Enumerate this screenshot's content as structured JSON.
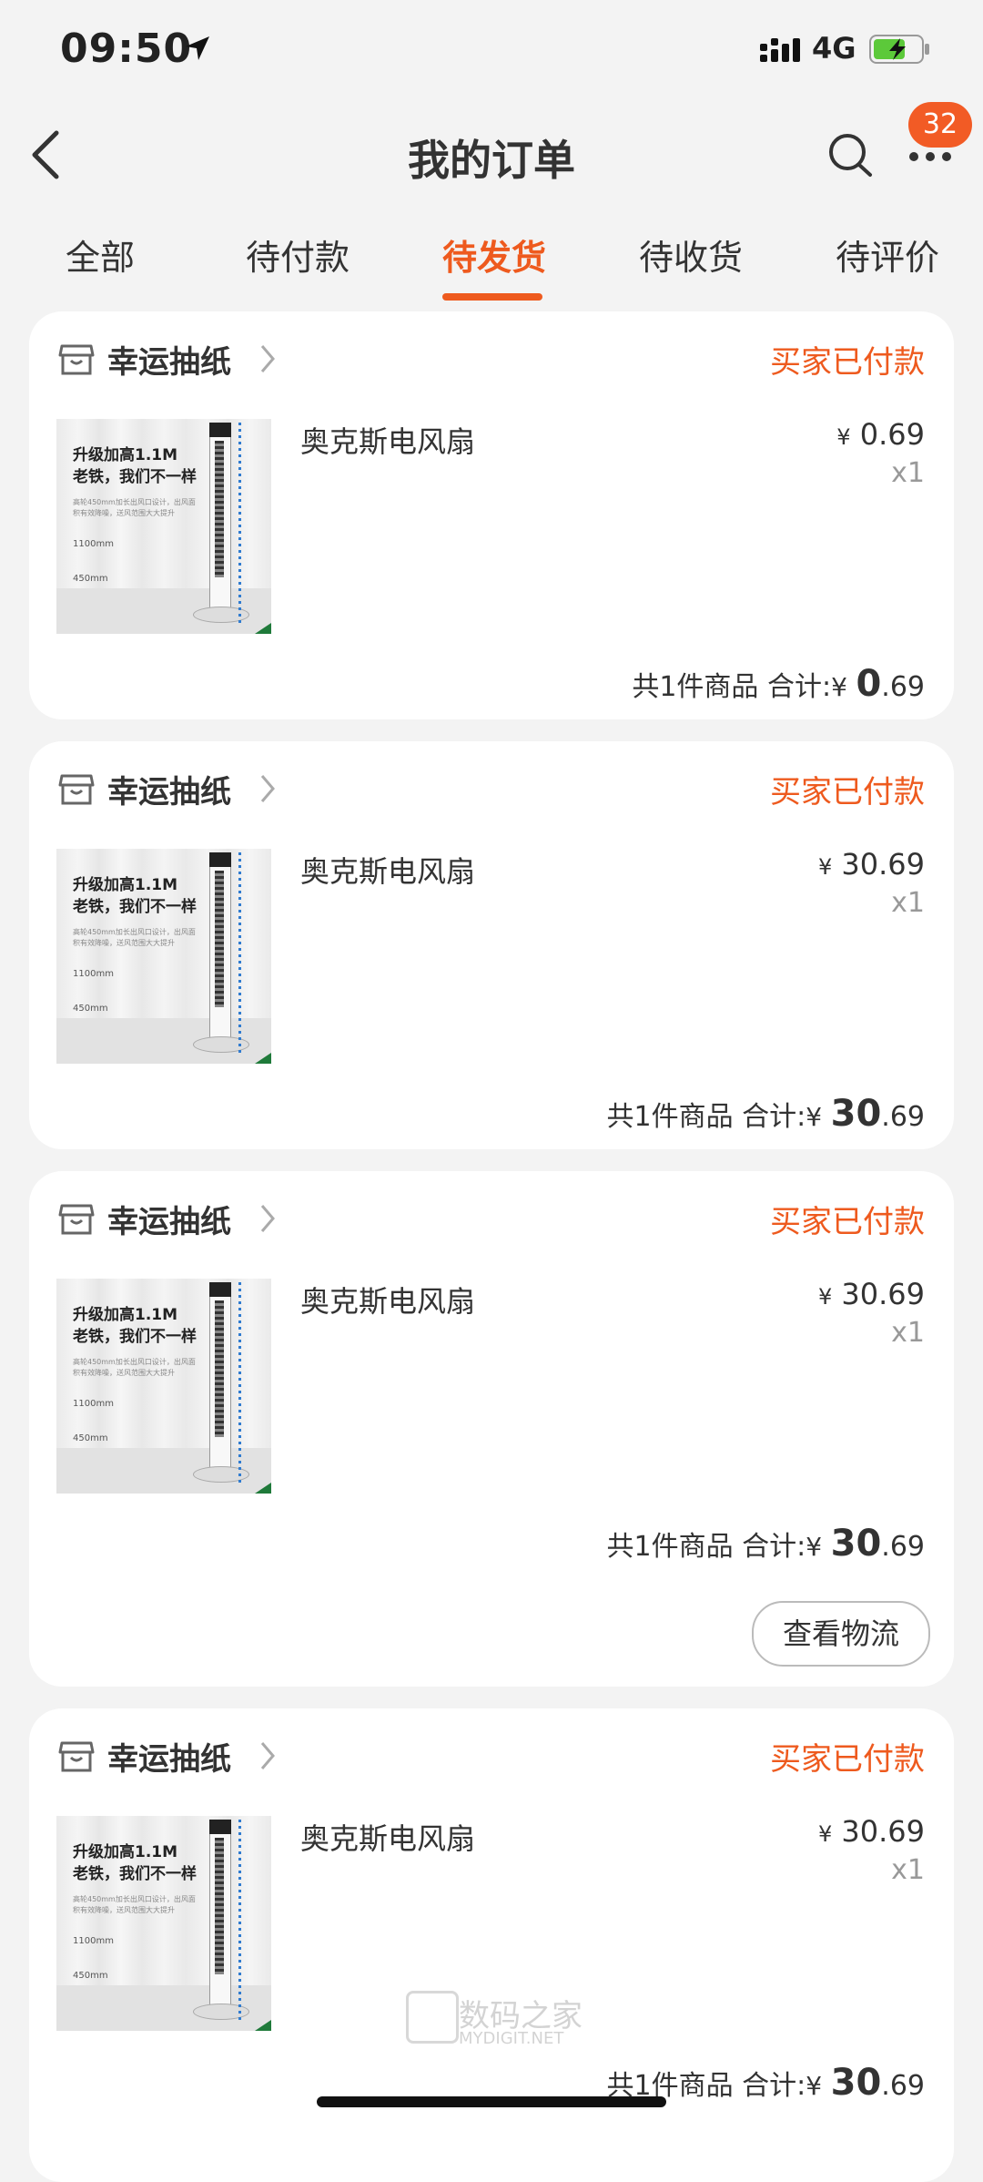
{
  "status_bar": {
    "time": "09:50",
    "network": "4G"
  },
  "header": {
    "title": "我的订单",
    "badge_count": "32"
  },
  "tabs": [
    {
      "label": "全部",
      "active": false
    },
    {
      "label": "待付款",
      "active": false
    },
    {
      "label": "待发货",
      "active": true
    },
    {
      "label": "待收货",
      "active": false
    },
    {
      "label": "待评价",
      "active": false
    }
  ],
  "orders": [
    {
      "shop": "幸运抽纸",
      "status": "买家已付款",
      "product": "奥克斯电风扇",
      "price_symbol": "¥",
      "price": "0.69",
      "qty": "x1",
      "summary": "共1件商品 合计:",
      "total_int": "0",
      "total_dec": ".69"
    },
    {
      "shop": "幸运抽纸",
      "status": "买家已付款",
      "product": "奥克斯电风扇",
      "price_symbol": "¥",
      "price": "30.69",
      "qty": "x1",
      "summary": "共1件商品 合计:",
      "total_int": "30",
      "total_dec": ".69"
    },
    {
      "shop": "幸运抽纸",
      "status": "买家已付款",
      "product": "奥克斯电风扇",
      "price_symbol": "¥",
      "price": "30.69",
      "qty": "x1",
      "summary": "共1件商品 合计:",
      "total_int": "30",
      "total_dec": ".69",
      "action": "查看物流"
    },
    {
      "shop": "幸运抽纸",
      "status": "买家已付款",
      "product": "奥克斯电风扇",
      "price_symbol": "¥",
      "price": "30.69",
      "qty": "x1",
      "summary": "共1件商品 合计:",
      "total_int": "30",
      "total_dec": ".69"
    }
  ],
  "product_image": {
    "headline_1": "升级加高1.1M",
    "headline_2": "老铁，我们不一样",
    "small_text": "高轮450mm加长出风口设计，出风面积有效降噪，送风范围大大提升",
    "spec_1": "1100mm",
    "spec_2": "450mm"
  },
  "watermark": {
    "cn": "数码之家",
    "en": "MYDIGIT.NET"
  },
  "colors": {
    "accent": "#ee5a1e",
    "badge": "#f25b25",
    "background": "#f3f3f3"
  },
  "icons": [
    "back-arrow-icon",
    "search-icon",
    "more-icon",
    "shop-icon",
    "chevron-right-icon",
    "location-arrow-icon",
    "signal-icon",
    "battery-icon"
  ]
}
